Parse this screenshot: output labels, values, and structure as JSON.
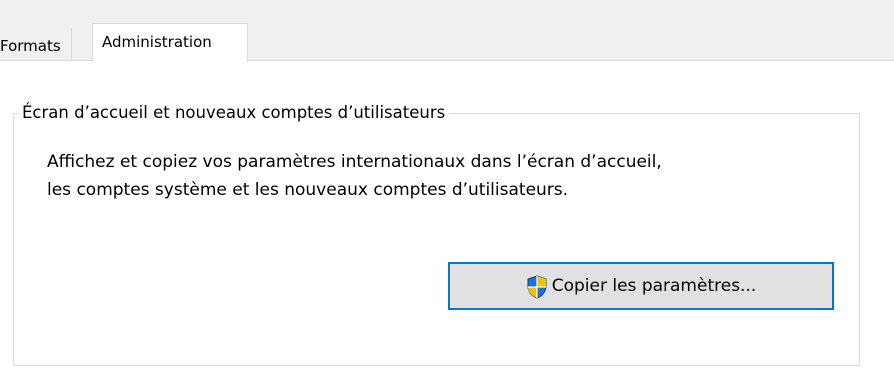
{
  "tabs": {
    "formats_label": "Formats",
    "administration_label": "Administration"
  },
  "group": {
    "legend": "Écran d’accueil et nouveaux comptes d’utilisateurs",
    "description_line1": "Affichez et copiez vos paramètres internationaux dans l’écran d’accueil,",
    "description_line2": "les comptes système et les nouveaux comptes d’utilisateurs.",
    "copy_button_label": "Copier les paramètres..."
  },
  "icons": {
    "copy_button_icon": "uac-shield-icon"
  },
  "colors": {
    "button_focus_border": "#0078d7",
    "shield_blue": "#1e6fd9",
    "shield_yellow": "#f2c200"
  }
}
